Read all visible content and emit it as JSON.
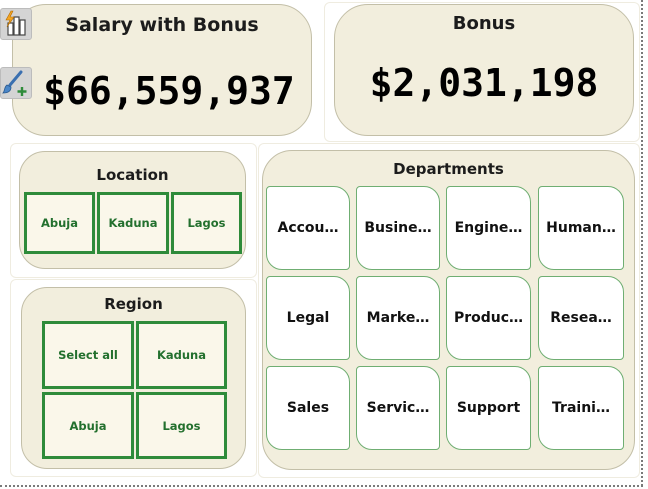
{
  "kpi": {
    "salary_title": "Salary with Bonus",
    "salary_value": "$66,559,937",
    "bonus_title": "Bonus",
    "bonus_value": "$2,031,198"
  },
  "location": {
    "title": "Location",
    "options": [
      "Abuja",
      "Kaduna",
      "Lagos"
    ]
  },
  "region": {
    "title": "Region",
    "options": [
      "Select all",
      "Kaduna",
      "Abuja",
      "Lagos"
    ]
  },
  "departments": {
    "title": "Departments",
    "items": [
      "Accou…",
      "Busine…",
      "Engine…",
      "Human…",
      "Legal",
      "Marke…",
      "Produc…",
      "Resea…",
      "Sales",
      "Servic…",
      "Support",
      "Traini…"
    ]
  },
  "toolbar": {
    "icons": [
      "chart-bolt-icon",
      "paintbrush-plus-icon"
    ]
  },
  "colors": {
    "card_bg": "#f2eedd",
    "slicer_border": "#2e8b3a",
    "slicer_text": "#23702e"
  }
}
